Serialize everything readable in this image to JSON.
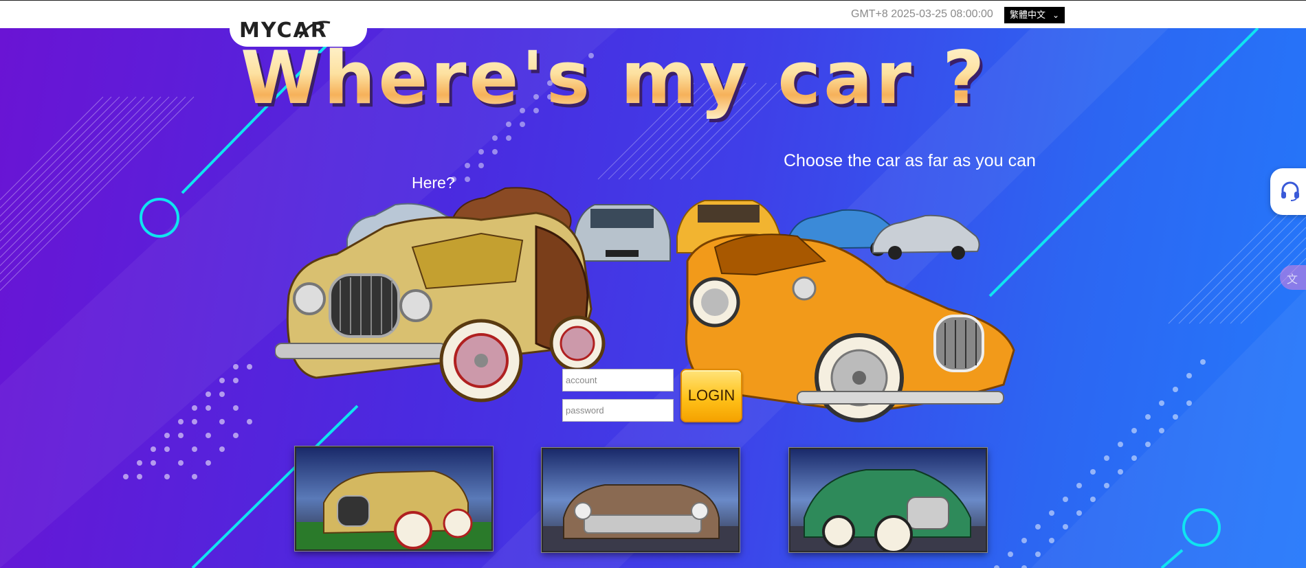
{
  "header": {
    "logo_text": "MYCAR",
    "datetime": "GMT+8 2025-03-25 08:00:00",
    "language": {
      "selected": "繁體中文"
    }
  },
  "hero": {
    "headline": "Where's my car ?",
    "tagline": "Choose the car as far as you can",
    "here_label": "Here?"
  },
  "login": {
    "account_placeholder": "account",
    "password_placeholder": "password",
    "button_label": "LOGIN"
  },
  "side_widgets": {
    "support_icon": "headset-icon",
    "translate_icon": "translate-icon"
  },
  "thumbnails": [
    {
      "car": "yellow-vintage-car-icon"
    },
    {
      "car": "cream-classic-car-icon"
    },
    {
      "car": "green-vintage-car-icon"
    }
  ],
  "colors": {
    "bg_left": "#6a14d4",
    "bg_right": "#2479fb",
    "accent_cyan": "#10e4f0",
    "login_yellow": "#ffc21a",
    "headline_gold": "#fde1a0"
  }
}
